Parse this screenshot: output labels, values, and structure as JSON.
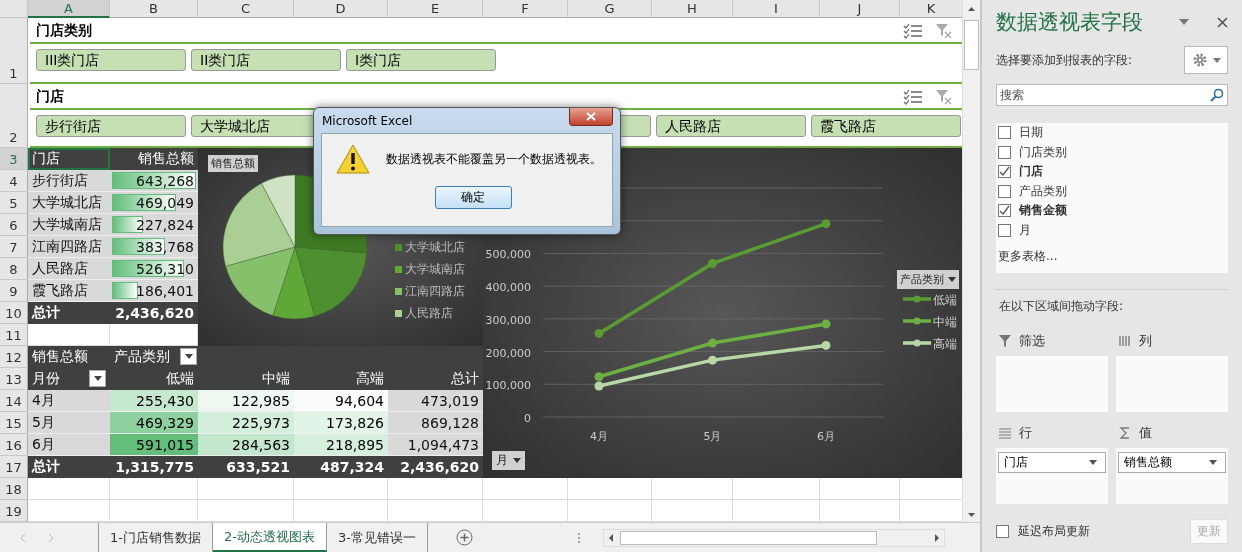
{
  "sheet": {
    "columns": [
      {
        "label": "A",
        "selected": true
      },
      {
        "label": "B",
        "selected": false
      },
      {
        "label": "C",
        "selected": false
      },
      {
        "label": "D",
        "selected": false
      },
      {
        "label": "E",
        "selected": false
      },
      {
        "label": "F",
        "selected": false
      },
      {
        "label": "G",
        "selected": false
      },
      {
        "label": "H",
        "selected": false
      },
      {
        "label": "I",
        "selected": false
      },
      {
        "label": "J",
        "selected": false
      },
      {
        "label": "K",
        "selected": false
      }
    ],
    "rows": [
      {
        "label": "1",
        "selected": false
      },
      {
        "label": "2",
        "selected": false
      },
      {
        "label": "3",
        "selected": true
      },
      {
        "label": "4",
        "selected": false
      },
      {
        "label": "5",
        "selected": false
      },
      {
        "label": "6",
        "selected": false
      },
      {
        "label": "7",
        "selected": false
      },
      {
        "label": "8",
        "selected": false
      },
      {
        "label": "9",
        "selected": false
      },
      {
        "label": "10",
        "selected": false
      },
      {
        "label": "11",
        "selected": false
      },
      {
        "label": "12",
        "selected": false
      },
      {
        "label": "13",
        "selected": false
      },
      {
        "label": "14",
        "selected": false
      },
      {
        "label": "15",
        "selected": false
      },
      {
        "label": "16",
        "selected": false
      },
      {
        "label": "17",
        "selected": false
      },
      {
        "label": "18",
        "selected": false
      },
      {
        "label": "19",
        "selected": false
      }
    ]
  },
  "slicers": [
    {
      "title": "门店类别",
      "items": [
        {
          "label": "III类门店",
          "selected": true
        },
        {
          "label": "II类门店",
          "selected": true
        },
        {
          "label": "I类门店",
          "selected": true
        }
      ]
    },
    {
      "title": "门店",
      "items": [
        {
          "label": "步行街店",
          "selected": true
        },
        {
          "label": "大学城北店",
          "selected": true
        },
        {
          "label": "人民路店",
          "selected": true
        },
        {
          "label": "霞飞路店",
          "selected": true
        }
      ]
    }
  ],
  "store_pivot": {
    "columns": [
      "门店",
      "销售总额"
    ],
    "header_selected": true,
    "rows": [
      {
        "store": "步行街店",
        "amount": "643,268",
        "level": 1.0
      },
      {
        "store": "大学城北店",
        "amount": "469,049",
        "level": 0.729
      },
      {
        "store": "大学城南店",
        "amount": "227,824",
        "level": 0.354
      },
      {
        "store": "江南四路店",
        "amount": "383,768",
        "level": 0.597
      },
      {
        "store": "人民路店",
        "amount": "526,310",
        "level": 0.818
      },
      {
        "store": "霞飞路店",
        "amount": "186,401",
        "level": 0.29
      }
    ],
    "total": {
      "label": "总计",
      "amount": "2,436,620"
    }
  },
  "month_pivot": {
    "value_label": "销售总额",
    "column_field": "产品类别",
    "row_field": "月份",
    "columns": [
      "低端",
      "中端",
      "高端",
      "总计"
    ],
    "rows": [
      {
        "label": "4月",
        "cells": [
          {
            "text": "255,430",
            "color": "#c6e8cf"
          },
          {
            "text": "122,985",
            "color": "#eef8f1"
          },
          {
            "text": "94,604",
            "color": "#fbfdfc"
          }
        ],
        "total": "473,019"
      },
      {
        "label": "5月",
        "cells": [
          {
            "text": "469,329",
            "color": "#8ed19f"
          },
          {
            "text": "225,973",
            "color": "#d3eedb"
          },
          {
            "text": "173,826",
            "color": "#e2f4e7"
          }
        ],
        "total": "869,128"
      },
      {
        "label": "6月",
        "cells": [
          {
            "text": "591,015",
            "color": "#63be7b"
          },
          {
            "text": "284,563",
            "color": "#c2e7cc"
          },
          {
            "text": "218,895",
            "color": "#d6efdd"
          }
        ],
        "total": "1,094,473"
      }
    ],
    "total": {
      "label": "总计",
      "cells": [
        "1,315,775",
        "633,521",
        "487,324"
      ],
      "total": "2,436,620"
    }
  },
  "pie_chart": {
    "title_button": "销售总额",
    "legend": [
      {
        "label": "大学城北店",
        "color": "#4e8f30"
      },
      {
        "label": "大学城南店",
        "color": "#5fa737"
      },
      {
        "label": "江南四路店",
        "color": "#87c06b"
      },
      {
        "label": "人民路店",
        "color": "#aacf94"
      }
    ]
  },
  "line_chart": {
    "field_button": "月",
    "legend_button": "产品类别",
    "chart_data": {
      "type": "line",
      "categories": [
        "4月",
        "5月",
        "6月"
      ],
      "series": [
        {
          "name": "低端",
          "color": "#5b9b33",
          "marker": "circle",
          "values": [
            255430,
            469329,
            591015
          ]
        },
        {
          "name": "中端",
          "color": "#6cb043",
          "marker": "circle",
          "values": [
            122985,
            225973,
            284563
          ]
        },
        {
          "name": "高端",
          "color": "#b7d7a6",
          "marker": "circle",
          "values": [
            94604,
            173826,
            218895
          ]
        }
      ],
      "grid": true,
      "legend": true,
      "ylim": [
        0,
        700000
      ],
      "yticks": [
        {
          "value": 0,
          "label": "0"
        },
        {
          "value": 100000,
          "label": "100,000"
        },
        {
          "value": 200000,
          "label": "200,000"
        },
        {
          "value": 300000,
          "label": "300,000"
        },
        {
          "value": 400000,
          "label": "400,000"
        },
        {
          "value": 500000,
          "label": "500,000"
        }
      ]
    }
  },
  "dialog": {
    "title": "Microsoft Excel",
    "message": "数据透视表不能覆盖另一个数据透视表。",
    "button": "确定"
  },
  "field_pane": {
    "title": "数据透视表字段",
    "subtitle": "选择要添加到报表的字段:",
    "search": {
      "placeholder": "搜索"
    },
    "fields": [
      {
        "label": "日期",
        "checked": false
      },
      {
        "label": "门店类别",
        "checked": false
      },
      {
        "label": "门店",
        "checked": true
      },
      {
        "label": "产品类别",
        "checked": false
      },
      {
        "label": "销售金额",
        "checked": true
      },
      {
        "label": "月",
        "checked": false
      }
    ],
    "more_tables": "更多表格...",
    "areas_label": "在以下区域间拖动字段:",
    "areas": [
      {
        "kind": "filter",
        "label": "筛选"
      },
      {
        "kind": "columns",
        "label": "列"
      },
      {
        "kind": "rows",
        "label": "行",
        "items": [
          "门店"
        ]
      },
      {
        "kind": "values",
        "label": "值",
        "items": [
          "销售总额"
        ]
      }
    ],
    "defer": {
      "label": "延迟布局更新",
      "checked": false
    },
    "update_button": {
      "label": "更新",
      "disabled": true
    }
  },
  "sheet_tabs": [
    {
      "label": "1-门店销售数据",
      "selected": false
    },
    {
      "label": "2-动态透视图表",
      "selected": true
    },
    {
      "label": "3-常见错误一",
      "selected": false
    }
  ]
}
